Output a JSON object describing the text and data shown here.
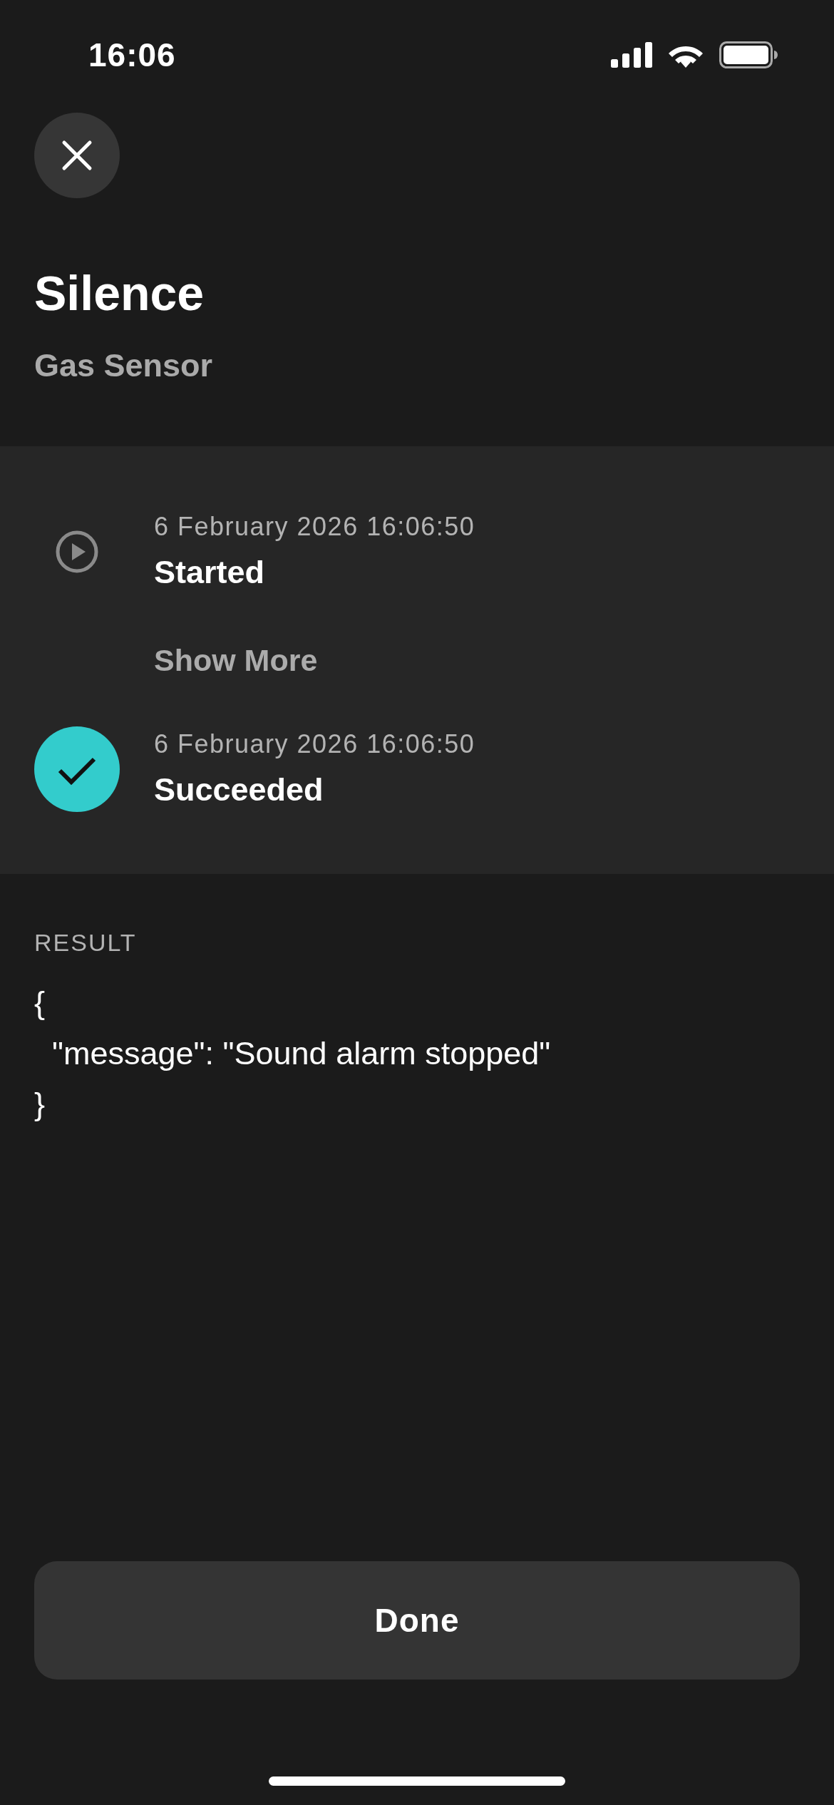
{
  "status_bar": {
    "time": "16:06"
  },
  "header": {
    "title": "Silence",
    "subtitle": "Gas Sensor"
  },
  "timeline": {
    "steps": [
      {
        "kind": "started",
        "timestamp": "6 February 2026 16:06:50",
        "label": "Started"
      },
      {
        "kind": "succeeded",
        "timestamp": "6 February 2026 16:06:50",
        "label": "Succeeded"
      }
    ],
    "show_more": "Show More"
  },
  "result": {
    "heading": "RESULT",
    "body": "{\n  \"message\": \"Sound alarm stopped\"\n}"
  },
  "done_button": "Done"
}
